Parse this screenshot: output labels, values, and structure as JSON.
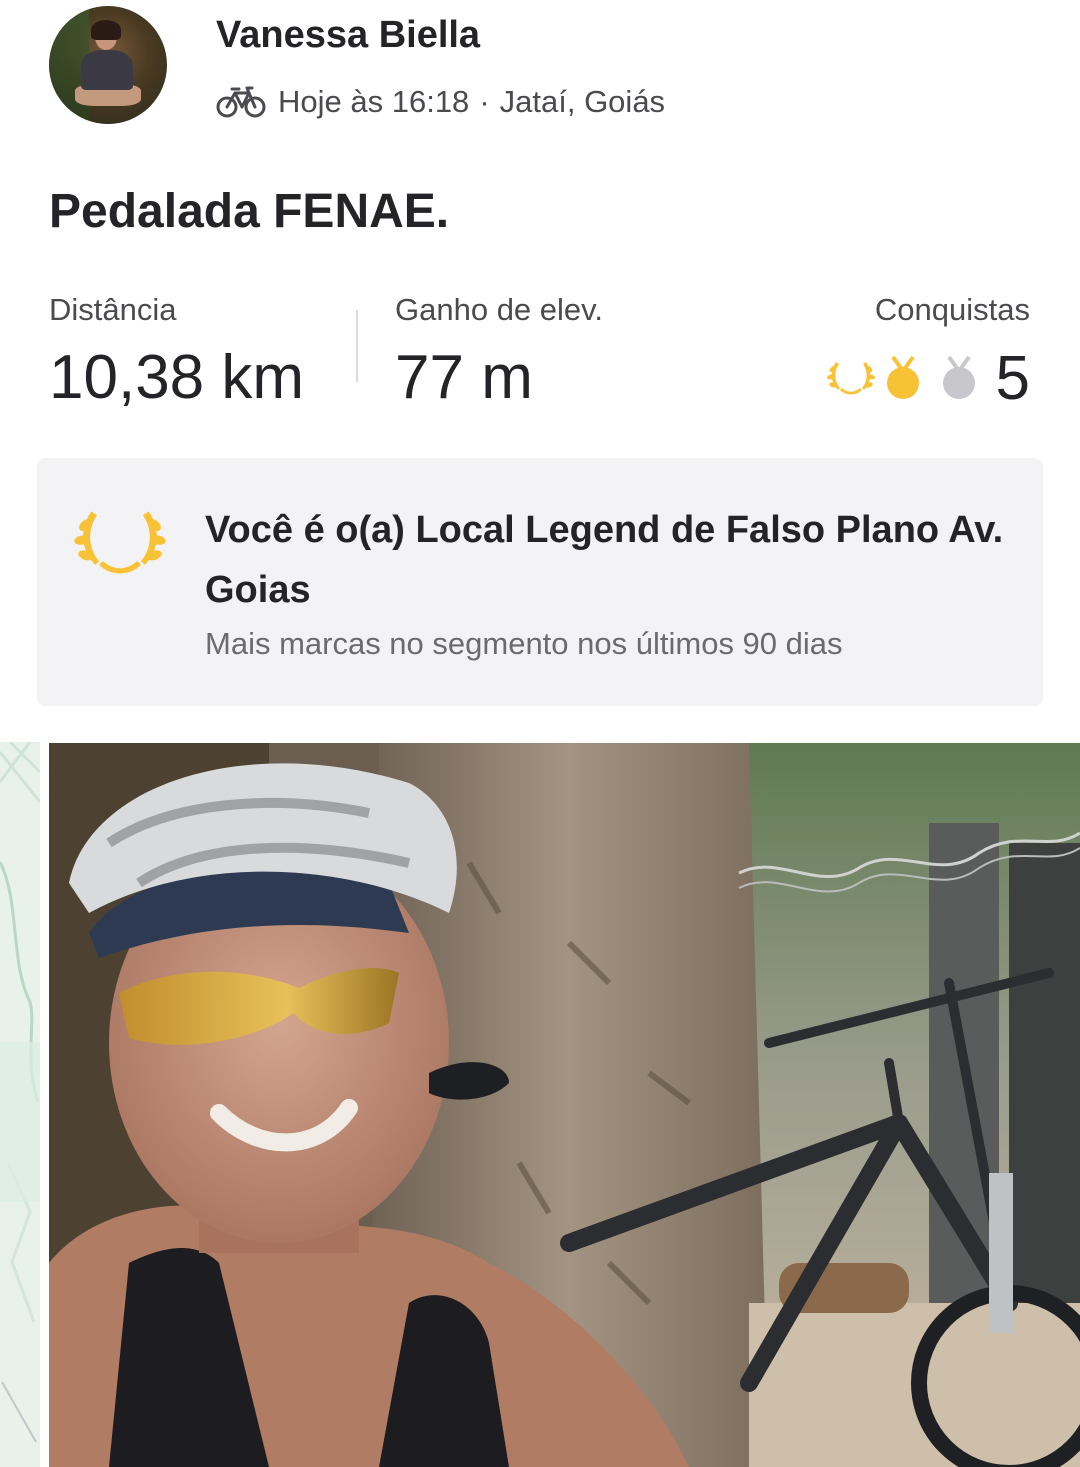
{
  "header": {
    "athlete_name": "Vanessa Biella",
    "activity_icon": "bike-icon",
    "time": "Hoje às 16:18",
    "separator": "·",
    "location": "Jataí, Goiás"
  },
  "activity": {
    "title": "Pedalada FENAE."
  },
  "stats": {
    "distance_label": "Distância",
    "distance_value": "10,38 km",
    "elevation_label": "Ganho de elev.",
    "elevation_value": "77 m",
    "achievements_label": "Conquistas",
    "achievements_count": "5",
    "achievement_icons": [
      "laurel-icon",
      "gold-medal-icon",
      "silver-medal-icon"
    ]
  },
  "local_legend": {
    "icon": "laurel-icon",
    "title": "Você é o(a) Local Legend de Falso Plano Av. Goias",
    "subtitle": "Mais marcas no segmento nos últimos 90 dias"
  },
  "media": {
    "map_thumbnail": "route-map",
    "photo": "selfie-with-bike-photo"
  },
  "colors": {
    "gold": "#f7c236",
    "silver": "#c8c8cc",
    "card_bg": "#f3f3f5",
    "text_primary": "#242428",
    "text_secondary": "#6a6a70"
  }
}
